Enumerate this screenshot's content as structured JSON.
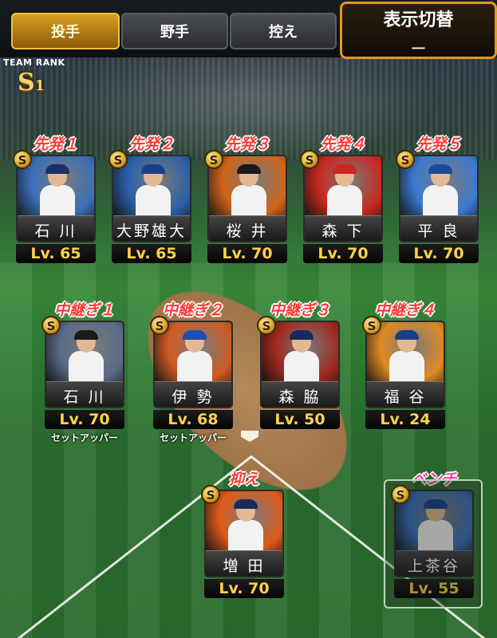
{
  "tabs": [
    {
      "label": "投手",
      "active": true
    },
    {
      "label": "野手",
      "active": false
    },
    {
      "label": "控え",
      "active": false
    }
  ],
  "display_switch": {
    "title": "表示切替",
    "value": "ー"
  },
  "team_rank": {
    "label": "TEAM RANK",
    "value": "S",
    "sub": "1"
  },
  "badge_letter": "S",
  "starters": [
    {
      "slot": "先発１",
      "name": "石 川",
      "level": "Lv. 65",
      "bg": "#3a6fb8",
      "cap": "#1b2f6a"
    },
    {
      "slot": "先発２",
      "name": "大野雄大",
      "level": "Lv. 65",
      "bg": "#2a5fa8",
      "cap": "#1a3f8a"
    },
    {
      "slot": "先発３",
      "name": "桜 井",
      "level": "Lv. 70",
      "bg": "#d0651a",
      "cap": "#1a1a1a"
    },
    {
      "slot": "先発４",
      "name": "森 下",
      "level": "Lv. 70",
      "bg": "#c8281e",
      "cap": "#c8281e"
    },
    {
      "slot": "先発５",
      "name": "平 良",
      "level": "Lv. 70",
      "bg": "#3a7ad0",
      "cap": "#1a4a9a"
    }
  ],
  "relievers": [
    {
      "slot": "中継ぎ１",
      "name": "石 川",
      "level": "Lv. 70",
      "role": "セットアッパー",
      "bg": "#5a6a88",
      "cap": "#1a1a1a"
    },
    {
      "slot": "中継ぎ２",
      "name": "伊 勢",
      "level": "Lv. 68",
      "role": "セットアッパー",
      "bg": "#d05a22",
      "cap": "#1b4fb0"
    },
    {
      "slot": "中継ぎ３",
      "name": "森 脇",
      "level": "Lv. 50",
      "role": "",
      "bg": "#a0281e",
      "cap": "#1a2a5a"
    },
    {
      "slot": "中継ぎ４",
      "name": "福 谷",
      "level": "Lv. 24",
      "role": "",
      "bg": "#e08a22",
      "cap": "#1a3f8a"
    }
  ],
  "closer": {
    "slot": "抑え",
    "name": "増 田",
    "level": "Lv. 70",
    "bg": "#e05a1a",
    "cap": "#1a2a5a"
  },
  "bench": {
    "slot": "ベンチ",
    "name": "上茶谷",
    "level": "Lv. 55",
    "bg": "#3a6fc0",
    "cap": "#1a3f8a"
  }
}
